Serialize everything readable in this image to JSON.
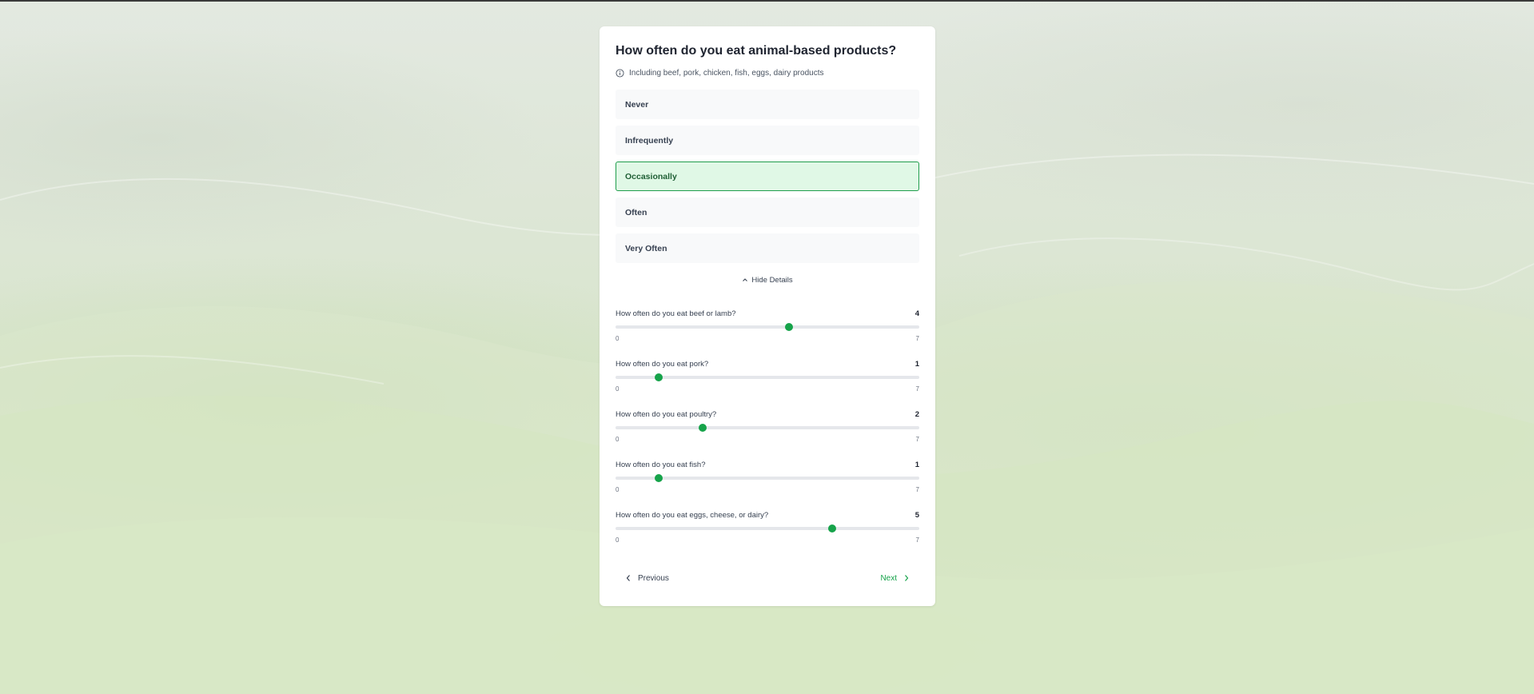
{
  "question": {
    "title": "How often do you eat animal-based products?",
    "subtitle": "Including beef, pork, chicken, fish, eggs, dairy products"
  },
  "options": [
    {
      "label": "Never",
      "selected": false
    },
    {
      "label": "Infrequently",
      "selected": false
    },
    {
      "label": "Occasionally",
      "selected": true
    },
    {
      "label": "Often",
      "selected": false
    },
    {
      "label": "Very Often",
      "selected": false
    }
  ],
  "details_toggle": {
    "label": "Hide Details",
    "icon": "chevron-up-icon"
  },
  "sliders": [
    {
      "label": "How often do you eat beef or lamb?",
      "value": 4,
      "min": "0",
      "max": "7",
      "value_text": "4"
    },
    {
      "label": "How often do you eat pork?",
      "value": 1,
      "min": "0",
      "max": "7",
      "value_text": "1"
    },
    {
      "label": "How often do you eat poultry?",
      "value": 2,
      "min": "0",
      "max": "7",
      "value_text": "2"
    },
    {
      "label": "How often do you eat fish?",
      "value": 1,
      "min": "0",
      "max": "7",
      "value_text": "1"
    },
    {
      "label": "How often do you eat eggs, cheese, or dairy?",
      "value": 5,
      "min": "0",
      "max": "7",
      "value_text": "5"
    }
  ],
  "navigation": {
    "previous_label": "Previous",
    "next_label": "Next"
  },
  "colors": {
    "accent": "#16a34a",
    "selected_bg": "#e0f8e6",
    "selected_border": "#1f9d4c"
  }
}
